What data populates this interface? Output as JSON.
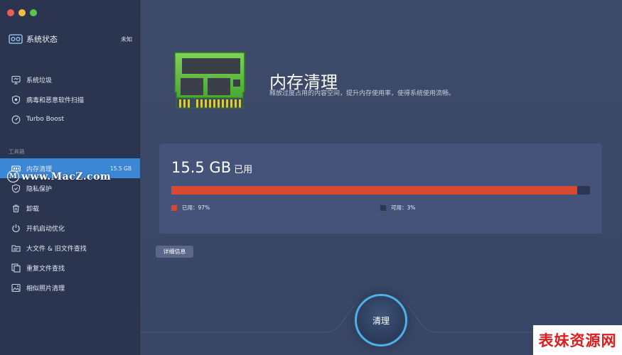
{
  "window": {
    "controls": [
      "close",
      "minimize",
      "zoom"
    ]
  },
  "sidebar": {
    "status": {
      "title": "系统状态",
      "value": "未知",
      "icon": "system-status-icon"
    },
    "top_items": [
      {
        "label": "系统垃圾",
        "icon": "monitor-icon"
      },
      {
        "label": "病毒和恶意软件扫描",
        "icon": "shield-scan-icon"
      },
      {
        "label": "Turbo Boost",
        "icon": "speedometer-icon"
      }
    ],
    "section_label": "工具箱",
    "tool_items": [
      {
        "label": "内存清理",
        "value": "15.5 GB",
        "icon": "memory-icon",
        "active": true
      },
      {
        "label": "隐私保护",
        "icon": "privacy-shield-icon"
      },
      {
        "label": "卸载",
        "icon": "trash-icon"
      },
      {
        "label": "开机启动优化",
        "icon": "power-icon"
      },
      {
        "label": "大文件 & 旧文件查找",
        "icon": "folder-search-icon"
      },
      {
        "label": "重复文件查找",
        "icon": "duplicate-files-icon"
      },
      {
        "label": "相似照片清理",
        "icon": "photo-icon"
      }
    ],
    "watermark": "www.MacZ.com",
    "watermark_badge": "M"
  },
  "main": {
    "title": "内存清理",
    "subtitle": "释放过度占用的内容空间，提升内存使用率，使得系统使用流畅。",
    "usage": {
      "amount": "15.5 GB",
      "unit_label": "已用",
      "used_fraction": 0.97,
      "legend_used": "已用：97%",
      "legend_free": "可用：3%",
      "used_color": "#d9492f",
      "free_color": "#2c3653"
    },
    "details_button": "详细信息",
    "clean_button": "清理"
  },
  "brand_watermark": "表妹资源网",
  "colors": {
    "accent": "#3c86d6",
    "ring": "#4fb0e8"
  }
}
